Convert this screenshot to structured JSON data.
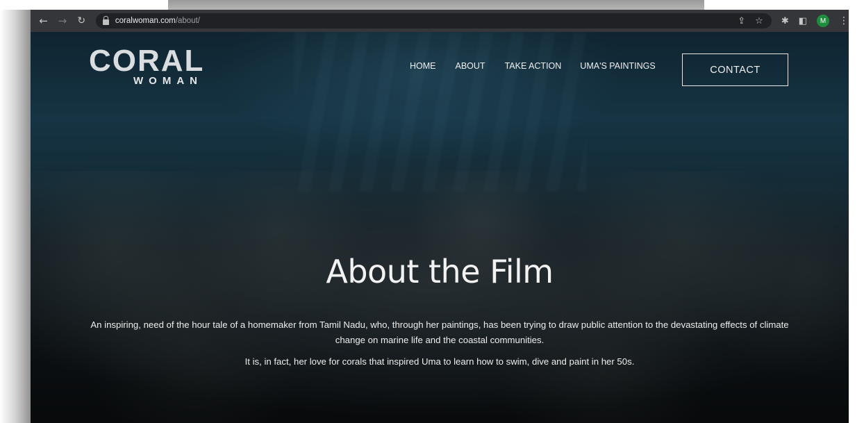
{
  "browser": {
    "url_host": "coralwoman.com",
    "url_path": "/about/",
    "profile_initial": "M"
  },
  "logo": {
    "main": "CORAL",
    "sub": "WOMAN"
  },
  "nav": {
    "items": [
      "HOME",
      "ABOUT",
      "TAKE ACTION",
      "UMA'S PAINTINGS"
    ],
    "contact": "CONTACT"
  },
  "hero": {
    "title": "About the Film",
    "paragraph1": "An inspiring, need of the hour tale of a homemaker from Tamil Nadu, who, through her paintings, has been trying to draw public attention to the devastating effects of climate change on marine life and the coastal communities.",
    "paragraph2": "It is, in fact, her love for corals that inspired Uma to learn how to swim, dive and paint in her 50s."
  },
  "icons": {
    "back": "back-arrow-icon",
    "forward": "forward-arrow-icon",
    "reload": "reload-icon",
    "lock": "lock-icon",
    "share": "share-icon",
    "bookmark": "star-icon",
    "extensions": "puzzle-icon",
    "sidepanel": "side-panel-icon",
    "menu": "kebab-menu-icon"
  }
}
